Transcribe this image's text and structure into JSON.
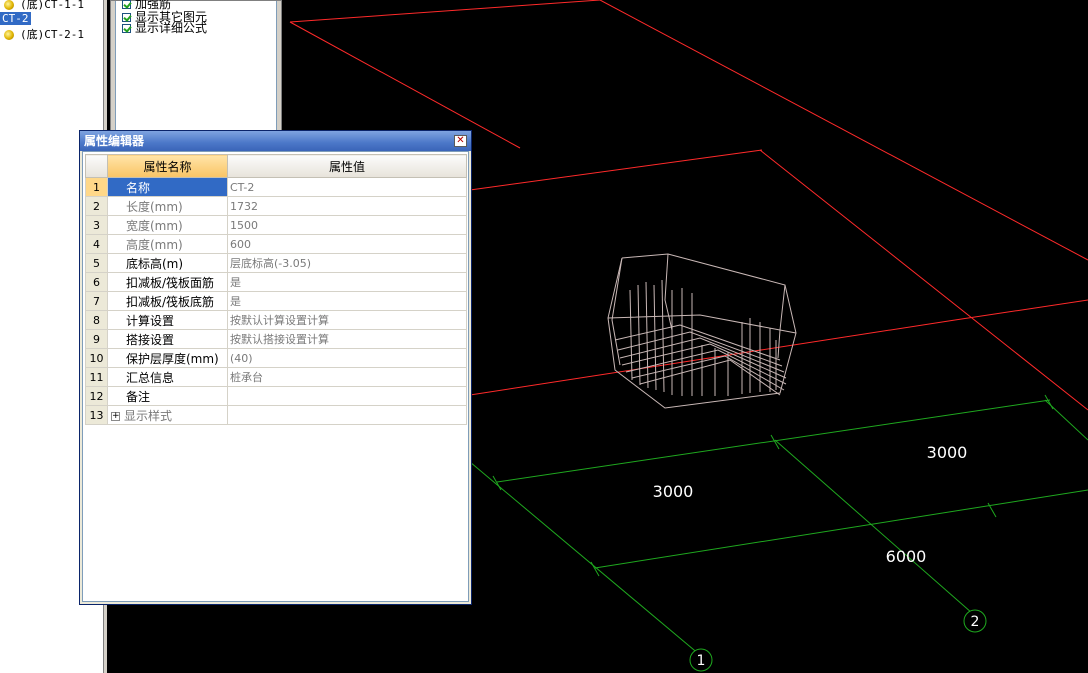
{
  "tree": {
    "items": [
      {
        "label": "(底)CT-1-1",
        "icon": "component-icon",
        "selected": false
      },
      {
        "label": "CT-2",
        "icon": "",
        "selected": true
      },
      {
        "label": "(底)CT-2-1",
        "icon": "component-icon",
        "selected": false
      }
    ]
  },
  "options": {
    "items": [
      {
        "label": "加强筋",
        "checked": true
      },
      {
        "label": "显示其它图元",
        "checked": true
      },
      {
        "label": "显示详细公式",
        "checked": true
      }
    ]
  },
  "property_editor": {
    "title": "属性编辑器",
    "close_icon": "close-icon",
    "headers": {
      "name": "属性名称",
      "value": "属性值"
    },
    "rows": [
      {
        "num": "1",
        "name": "名称",
        "value": "CT-2",
        "style": "selected"
      },
      {
        "num": "2",
        "name": "长度(mm)",
        "value": "1732",
        "style": "grey"
      },
      {
        "num": "3",
        "name": "宽度(mm)",
        "value": "1500",
        "style": "grey"
      },
      {
        "num": "4",
        "name": "高度(mm)",
        "value": "600",
        "style": "grey"
      },
      {
        "num": "5",
        "name": "底标高(m)",
        "value": "层底标高(-3.05)",
        "style": "normal"
      },
      {
        "num": "6",
        "name": "扣减板/筏板面筋",
        "value": "是",
        "style": "normal"
      },
      {
        "num": "7",
        "name": "扣减板/筏板底筋",
        "value": "是",
        "style": "normal"
      },
      {
        "num": "8",
        "name": "计算设置",
        "value": "按默认计算设置计算",
        "style": "normal"
      },
      {
        "num": "9",
        "name": "搭接设置",
        "value": "按默认搭接设置计算",
        "style": "normal"
      },
      {
        "num": "10",
        "name": "保护层厚度(mm)",
        "value": "(40)",
        "style": "normal"
      },
      {
        "num": "11",
        "name": "汇总信息",
        "value": "桩承台",
        "style": "normal"
      },
      {
        "num": "12",
        "name": "备注",
        "value": "",
        "style": "normal"
      },
      {
        "num": "13",
        "name": "显示样式",
        "value": "",
        "style": "expander"
      }
    ],
    "expander_symbol": "+"
  },
  "viewport": {
    "dimensions": [
      {
        "label": "3000"
      },
      {
        "label": "3000"
      },
      {
        "label": "6000"
      }
    ],
    "axes": [
      {
        "label": "1"
      },
      {
        "label": "2"
      }
    ],
    "colors": {
      "background": "#000000",
      "grid_red": "#ff2a2a",
      "grid_green": "#1fa81f",
      "rebar": "#c9b8b6",
      "text": "#ffffff"
    }
  }
}
